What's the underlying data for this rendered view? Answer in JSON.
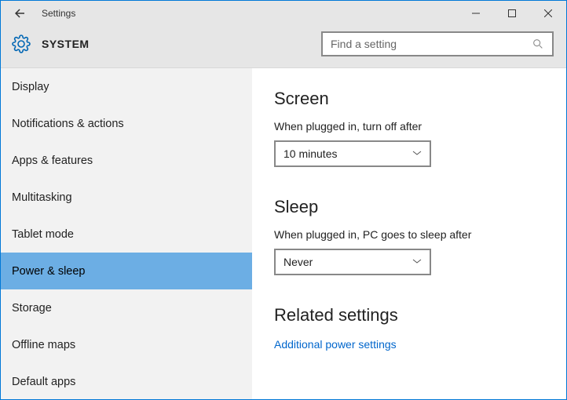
{
  "window": {
    "title": "Settings"
  },
  "header": {
    "title": "SYSTEM"
  },
  "search": {
    "placeholder": "Find a setting"
  },
  "sidebar": {
    "items": [
      {
        "label": "Display"
      },
      {
        "label": "Notifications & actions"
      },
      {
        "label": "Apps & features"
      },
      {
        "label": "Multitasking"
      },
      {
        "label": "Tablet mode"
      },
      {
        "label": "Power & sleep"
      },
      {
        "label": "Storage"
      },
      {
        "label": "Offline maps"
      },
      {
        "label": "Default apps"
      }
    ]
  },
  "main": {
    "screen_h": "Screen",
    "screen_label": "When plugged in, turn off after",
    "screen_value": "10 minutes",
    "sleep_h": "Sleep",
    "sleep_label": "When plugged in, PC goes to sleep after",
    "sleep_value": "Never",
    "related_h": "Related settings",
    "related_link": "Additional power settings"
  }
}
